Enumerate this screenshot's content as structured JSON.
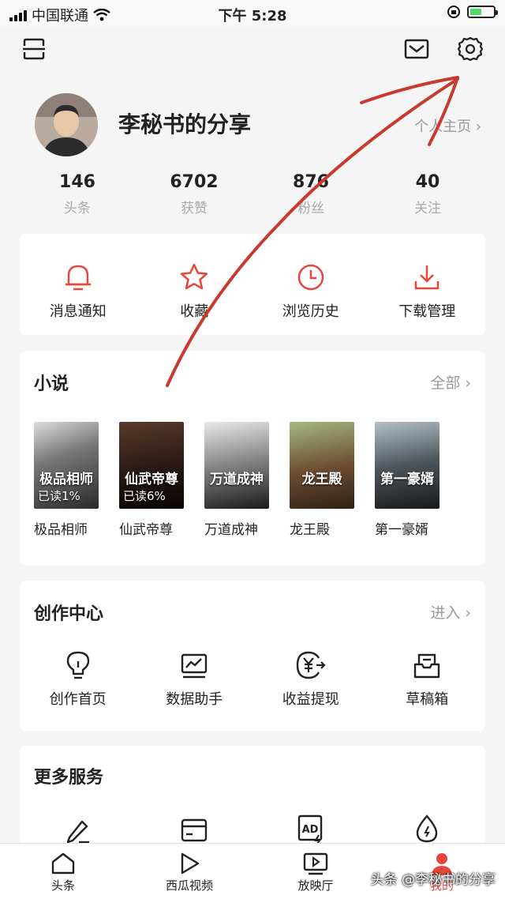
{
  "status_bar": {
    "carrier": "中国联通",
    "time": "下午 5:28"
  },
  "profile": {
    "name": "李秘书的分享",
    "homepage_link": "个人主页 ›"
  },
  "stats": [
    {
      "value": "146",
      "label": "头条"
    },
    {
      "value": "6702",
      "label": "获赞"
    },
    {
      "value": "876",
      "label": "粉丝"
    },
    {
      "value": "40",
      "label": "关注"
    }
  ],
  "quick_actions": [
    {
      "label": "消息通知",
      "icon": "bell-icon"
    },
    {
      "label": "收藏",
      "icon": "star-icon"
    },
    {
      "label": "浏览历史",
      "icon": "clock-icon"
    },
    {
      "label": "下载管理",
      "icon": "download-icon"
    }
  ],
  "novels": {
    "title": "小说",
    "more": "全部 ›",
    "books": [
      {
        "name": "极品相师",
        "cover_title": "极品相师",
        "progress": "已读1%"
      },
      {
        "name": "仙武帝尊",
        "cover_title": "仙武帝尊",
        "progress": "已读6%"
      },
      {
        "name": "万道成神",
        "cover_title": "万道成神",
        "progress": ""
      },
      {
        "name": "龙王殿",
        "cover_title": "龙王殿",
        "progress": ""
      },
      {
        "name": "第一豪婿",
        "cover_title": "第一豪婿",
        "progress": ""
      }
    ]
  },
  "creation": {
    "title": "创作中心",
    "more": "进入 ›",
    "items": [
      {
        "label": "创作首页",
        "icon": "bulb-icon"
      },
      {
        "label": "数据助手",
        "icon": "chart-icon"
      },
      {
        "label": "收益提现",
        "icon": "yuan-icon"
      },
      {
        "label": "草稿箱",
        "icon": "drafts-icon"
      }
    ]
  },
  "services": {
    "title": "更多服务",
    "items": [
      {
        "icon": "pen-icon"
      },
      {
        "icon": "wallet-icon"
      },
      {
        "icon": "ad-icon",
        "text": "AD"
      },
      {
        "icon": "drop-icon"
      }
    ]
  },
  "tabbar": [
    {
      "label": "头条",
      "icon": "home-icon"
    },
    {
      "label": "西瓜视频",
      "icon": "play-icon"
    },
    {
      "label": "放映厅",
      "icon": "theater-icon"
    },
    {
      "label": "我的",
      "icon": "user-icon",
      "active": true
    }
  ],
  "watermark": "头条 @李秘书的分享",
  "colors": {
    "accent": "#e8463b",
    "muted": "#999999",
    "background": "#f5f5f5"
  }
}
